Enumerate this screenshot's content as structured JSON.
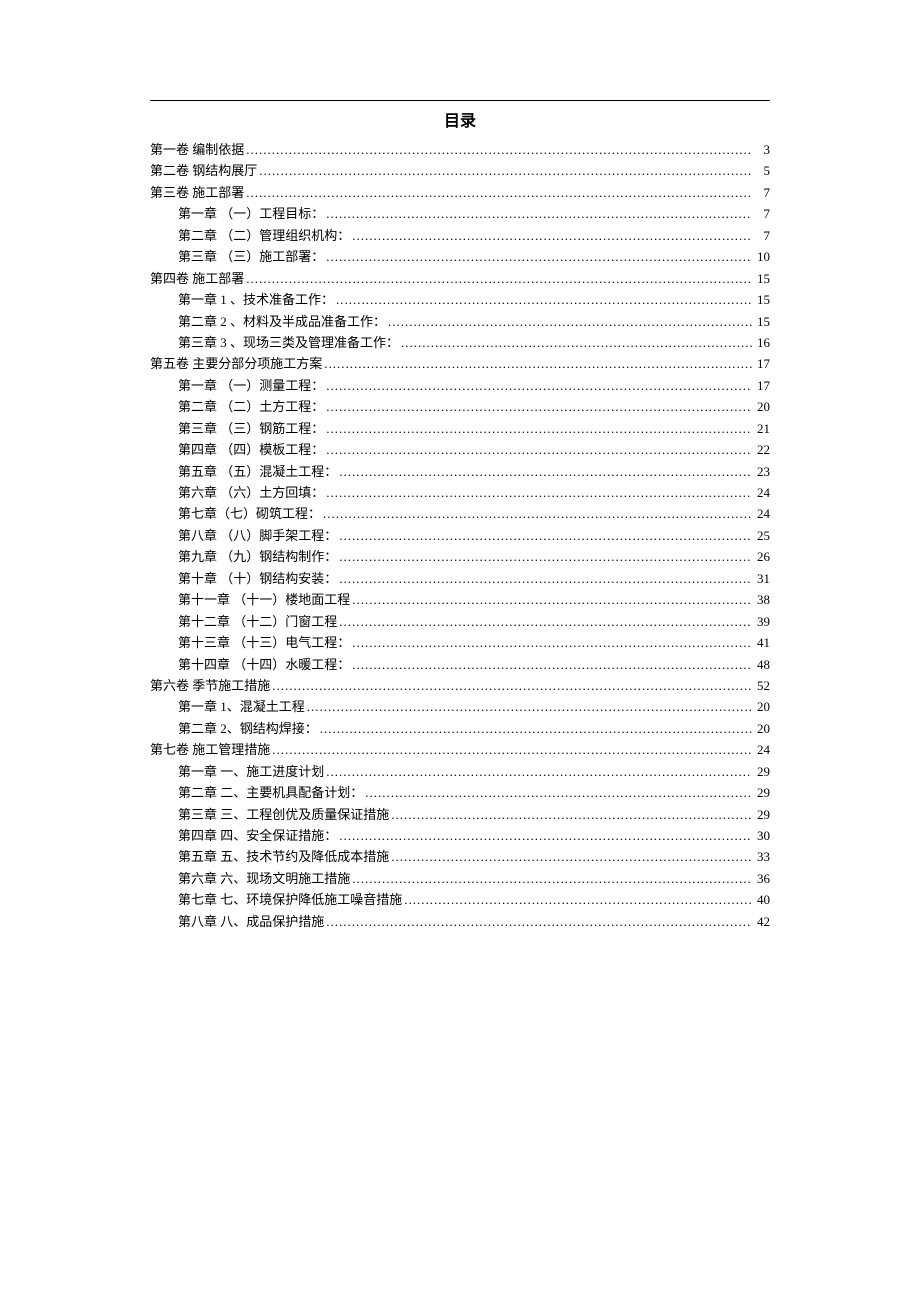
{
  "title": "目录",
  "entries": [
    {
      "level": 1,
      "label": "第一卷 编制依据",
      "page": "3"
    },
    {
      "level": 1,
      "label": "第二卷 钢结构展厅",
      "page": "5"
    },
    {
      "level": 1,
      "label": "第三卷 施工部署",
      "page": "7"
    },
    {
      "level": 2,
      "label": "第一章 （一）工程目标：",
      "page": "7"
    },
    {
      "level": 2,
      "label": "第二章 （二）管理组织机构：",
      "page": "7"
    },
    {
      "level": 2,
      "label": "第三章 （三）施工部署：",
      "page": "10"
    },
    {
      "level": 1,
      "label": "第四卷 施工部署",
      "page": "15"
    },
    {
      "level": 2,
      "label": "第一章 1 、技术准备工作：",
      "page": "15"
    },
    {
      "level": 2,
      "label": "第二章 2 、材料及半成品准备工作：",
      "page": "15"
    },
    {
      "level": 2,
      "label": "第三章 3 、现场三类及管理准备工作：",
      "page": "16"
    },
    {
      "level": 1,
      "label": "第五卷 主要分部分项施工方案",
      "page": "17"
    },
    {
      "level": 2,
      "label": "第一章 （一）测量工程：",
      "page": "17"
    },
    {
      "level": 2,
      "label": "第二章 （二）土方工程：",
      "page": "20"
    },
    {
      "level": 2,
      "label": "第三章 （三）钢筋工程：",
      "page": "21"
    },
    {
      "level": 2,
      "label": "第四章 （四）模板工程：",
      "page": "22"
    },
    {
      "level": 2,
      "label": "第五章 （五）混凝土工程：",
      "page": "23"
    },
    {
      "level": 2,
      "label": "第六章 （六）土方回填：",
      "page": "24"
    },
    {
      "level": 2,
      "label": "第七章（七）砌筑工程：",
      "page": "24"
    },
    {
      "level": 2,
      "label": "第八章 （八）脚手架工程：",
      "page": "25"
    },
    {
      "level": 2,
      "label": "第九章 （九）钢结构制作：",
      "page": "26"
    },
    {
      "level": 2,
      "label": "第十章 （十）钢结构安装：",
      "page": "31"
    },
    {
      "level": 2,
      "label": "第十一章 （十一）楼地面工程",
      "page": "38"
    },
    {
      "level": 2,
      "label": "第十二章 （十二）门窗工程",
      "page": "39"
    },
    {
      "level": 2,
      "label": "第十三章 （十三）电气工程：",
      "page": "41"
    },
    {
      "level": 2,
      "label": "第十四章 （十四）水暖工程：",
      "page": "48"
    },
    {
      "level": 1,
      "label": "第六卷 季节施工措施",
      "page": "52"
    },
    {
      "level": 2,
      "label": "第一章 1、混凝土工程",
      "page": "20"
    },
    {
      "level": 2,
      "label": "第二章 2、钢结构焊接：",
      "page": "20"
    },
    {
      "level": 1,
      "label": "第七卷 施工管理措施",
      "page": "24"
    },
    {
      "level": 2,
      "label": "第一章 一、施工进度计划",
      "page": "29"
    },
    {
      "level": 2,
      "label": "第二章 二、主要机具配备计划：",
      "page": "29"
    },
    {
      "level": 2,
      "label": "第三章 三、工程创优及质量保证措施",
      "page": "29"
    },
    {
      "level": 2,
      "label": "第四章 四、安全保证措施：",
      "page": "30"
    },
    {
      "level": 2,
      "label": "第五章 五、技术节约及降低成本措施",
      "page": "33"
    },
    {
      "level": 2,
      "label": "第六章 六、现场文明施工措施",
      "page": "36"
    },
    {
      "level": 2,
      "label": "第七章 七、环境保护降低施工噪音措施",
      "page": "40"
    },
    {
      "level": 2,
      "label": "第八章 八、成品保护措施",
      "page": "42"
    }
  ]
}
